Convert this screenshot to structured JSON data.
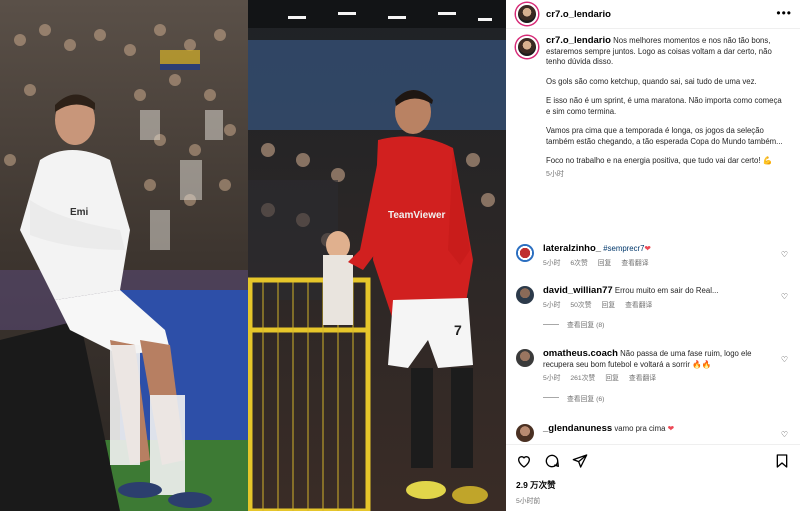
{
  "post": {
    "username": "cr7.o_lendario",
    "more_icon": "more-horizontal-icon",
    "caption": {
      "username": "cr7.o_lendario",
      "p1": "Nos melhores momentos e nos não tão bons, estaremos sempre juntos. Logo as coisas voltam a dar certo, não tenho dúvida disso.",
      "p2": "Os gols são como ketchup, quando sai, sai tudo de uma vez.",
      "p3": "E isso não é um sprint, é uma maratona. Não importa como começa e sim como termina.",
      "p4": "Vamos pra cima que a temporada é longa, os jogos da seleção também estão chegando, a tão esperada Copa do Mundo também...",
      "p5": "Foco no trabalho e na energia positiva, que tudo vai dar certo! 💪",
      "time": "5小时"
    },
    "comments": [
      {
        "username": "lateralzinho_",
        "text": "#semprecr7",
        "heart": "❤",
        "time": "5小时",
        "likes": "6次赞",
        "reply": "回复",
        "translate": "查看翻译"
      },
      {
        "username": "david_willian77",
        "text": "Errou muito em sair do Real...",
        "time": "5小时",
        "likes": "50次赞",
        "reply": "回复",
        "translate": "查看翻译",
        "view_replies": "查看回复 (8)"
      },
      {
        "username": "omatheus.coach",
        "text": "Não passa de uma fase ruim, logo ele recupera seu bom futebol e voltará a sorrir 🔥🔥",
        "time": "5小时",
        "likes": "261次赞",
        "reply": "回复",
        "translate": "查看翻译",
        "view_replies": "查看回复 (6)"
      },
      {
        "username": "_glendanuness",
        "text": "vamo pra cima",
        "heart": "❤"
      }
    ],
    "likes": "2.9 万次赞",
    "time": "5小时前"
  },
  "colors": {
    "accent": "#00376b",
    "heart": "#ed4956",
    "muted": "#737373"
  }
}
